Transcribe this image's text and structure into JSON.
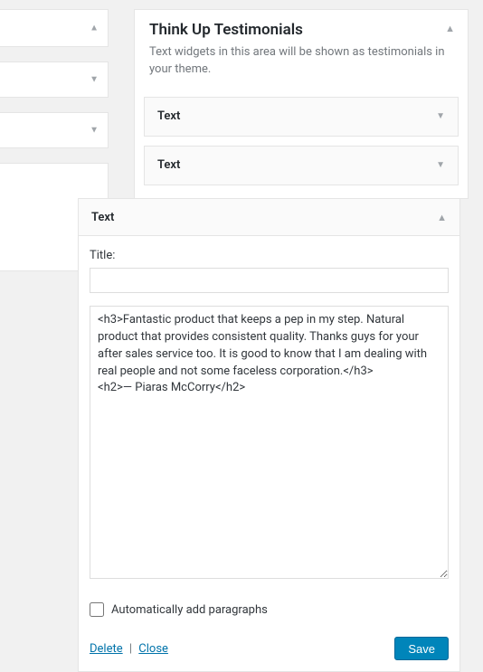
{
  "left_col": {
    "boxes": [
      {
        "collapsed": true
      },
      {
        "collapsed": false
      },
      {
        "collapsed": false
      },
      {
        "collapsed": false
      }
    ]
  },
  "area": {
    "title": "Think Up Testimonials",
    "description": "Text widgets in this area will be shown as testimonials in your theme.",
    "widgets": [
      {
        "label": "Text"
      },
      {
        "label": "Text"
      }
    ]
  },
  "editor": {
    "widget_label": "Text",
    "title_label": "Title:",
    "title_value": "",
    "content_value": "<h3>Fantastic product that keeps a pep in my step. Natural product that provides consistent quality. Thanks guys for your after sales service too. It is good to know that I am dealing with real people and not some faceless corporation.</h3>\n<h2>— Piaras McCorry</h2>",
    "autop_label": "Automatically add paragraphs",
    "autop_checked": false,
    "delete_label": "Delete",
    "close_label": "Close",
    "save_label": "Save"
  }
}
